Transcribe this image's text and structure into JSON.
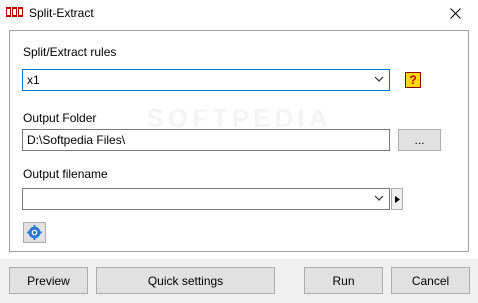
{
  "window": {
    "title": "Split-Extract",
    "icon": "app-logo-icon",
    "close_icon": "close-icon"
  },
  "rules": {
    "label": "Split/Extract rules",
    "selected": "x1",
    "help_icon": "help-question-icon"
  },
  "output_folder": {
    "label": "Output Folder",
    "value": "D:\\Softpedia Files\\",
    "browse_label": "..."
  },
  "output_filename": {
    "label": "Output filename",
    "value": ""
  },
  "settings_icon": "gear-settings-icon",
  "watermark": "SOFTPEDIA",
  "buttons": {
    "preview": "Preview",
    "quick_settings": "Quick settings",
    "run": "Run",
    "cancel": "Cancel"
  }
}
